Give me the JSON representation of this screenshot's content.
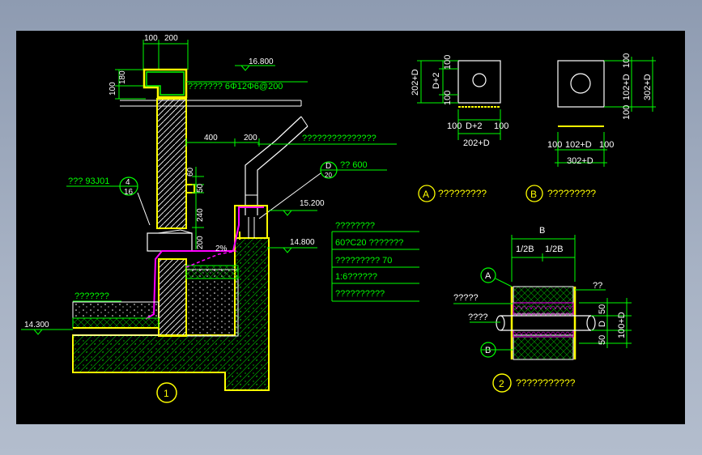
{
  "colors": {
    "background": "#000000",
    "outline": "#ffff00",
    "dimension": "#00ff00",
    "hatch": "#00ff00",
    "waterproof": "#ff00ff",
    "text": "#ffffff"
  },
  "section1": {
    "dim_top": [
      "100",
      "200"
    ],
    "dim_left": "100",
    "dim_left2": "180",
    "elev_top": "16.800",
    "callout_parapet": "???????  6Φ12Φ6@200",
    "dim_400": "400",
    "dim_200_top": "200",
    "callout_pipe": "???????????????",
    "dim_60": "60",
    "dim_50": "50",
    "dim_240": "240",
    "dim_200": "200",
    "slope": "2%",
    "detail_ref_d": "D",
    "detail_ref_d_sub": "20",
    "callout_600": "?? 600",
    "elev_15200": "15.200",
    "detail_4_top": "4",
    "detail_4_bottom": "16",
    "callout_93j01": "??? 93J01",
    "elev_14800": "14.800",
    "layer_list": [
      "????????",
      "60?C20  ???????",
      "?????????  70",
      "1:6??????",
      "??????????"
    ],
    "callout_left": "???????",
    "elev_14300": "14.300",
    "label": "1"
  },
  "detailA": {
    "dim_202d": "202+D",
    "dim_100a": "100",
    "dim_d2": "D+2",
    "dim_100b": "100",
    "bottom_dims": [
      "100",
      "D+2",
      "100"
    ],
    "bottom_total": "202+D",
    "label": "A",
    "caption": "?????????"
  },
  "detailB": {
    "right_dims": [
      "100",
      "102+D",
      "100"
    ],
    "right_total": "302+D",
    "bottom_dims": [
      "100",
      "102+D",
      "100"
    ],
    "bottom_total": "302+D",
    "label": "B",
    "caption": "?????????"
  },
  "section2": {
    "top_label": "B",
    "halves": [
      "1/2B",
      "1/2B"
    ],
    "marker_a": "A",
    "marker_b": "B",
    "callout1": "?????",
    "callout2": "????",
    "callout_right": "??",
    "dim_50a": "50",
    "dim_d": "D",
    "dim_50b": "50",
    "dim_total": "100+D",
    "label": "2",
    "caption": "???????????"
  }
}
